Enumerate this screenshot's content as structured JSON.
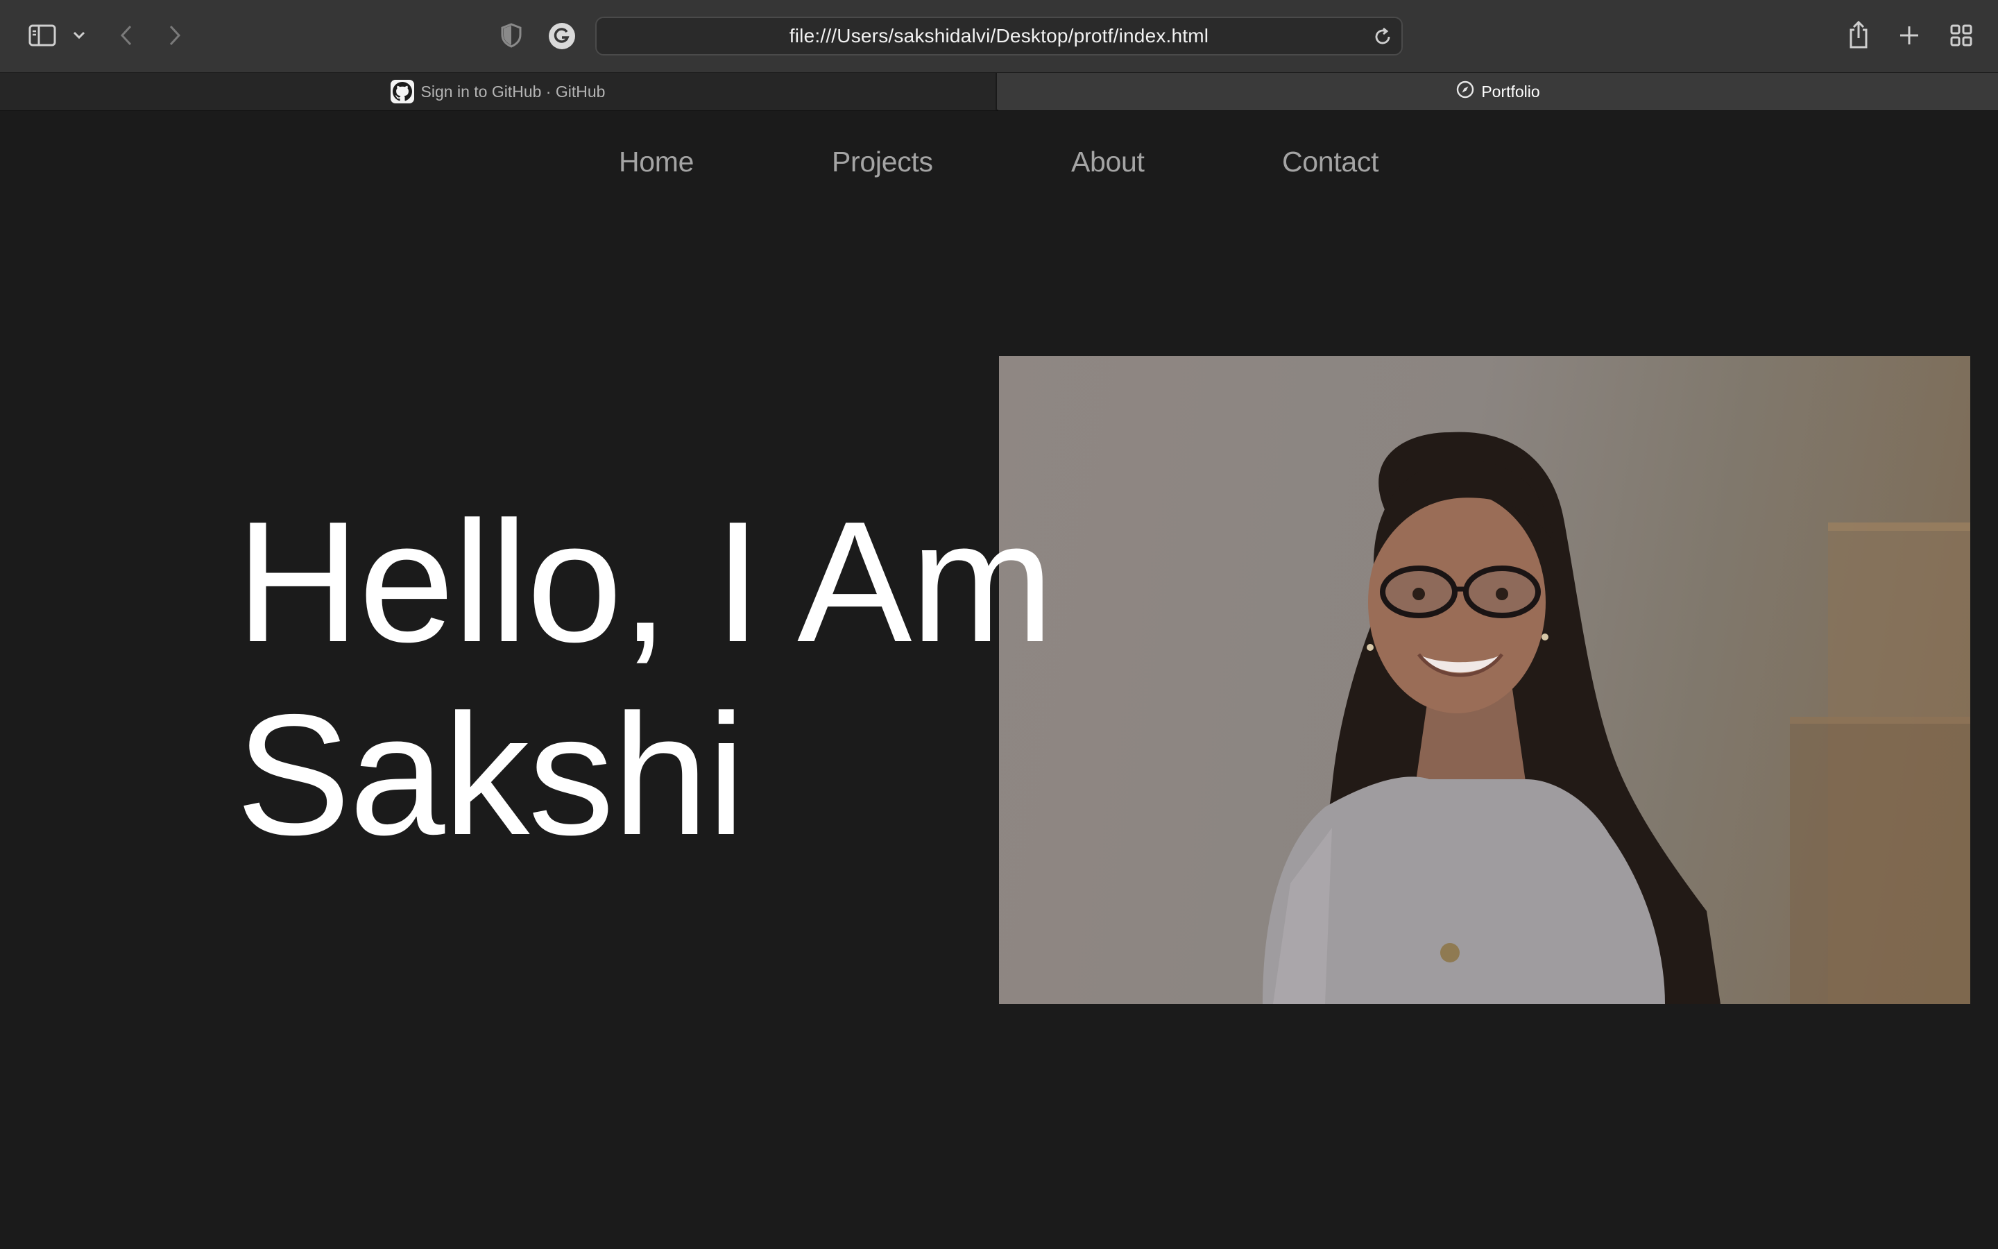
{
  "browser": {
    "url": "file:///Users/sakshidalvi/Desktop/protf/index.html",
    "tabs": [
      {
        "title": "Sign in to GitHub · GitHub",
        "icon": "github-icon",
        "active": false
      },
      {
        "title": "Portfolio",
        "icon": "compass-icon",
        "active": true
      }
    ],
    "toolbar_icons": [
      "sidebar-icon",
      "chevron-down-icon",
      "back-icon",
      "forward-icon",
      "shield-icon",
      "grammarly-icon",
      "reload-icon",
      "share-icon",
      "plus-icon",
      "tab-overview-icon"
    ]
  },
  "nav": {
    "items": [
      {
        "label": "Home"
      },
      {
        "label": "Projects"
      },
      {
        "label": "About"
      },
      {
        "label": "Contact"
      }
    ]
  },
  "hero": {
    "title_line1": "Hello, I Am",
    "title_line2": "Sakshi",
    "photo": "portrait of a smiling woman with long dark hair and glasses"
  },
  "colors": {
    "page_bg": "#1b1b1b",
    "nav_text": "#a4a4a4",
    "title_text": "#ffffff",
    "toolbar_bg": "#363636"
  }
}
